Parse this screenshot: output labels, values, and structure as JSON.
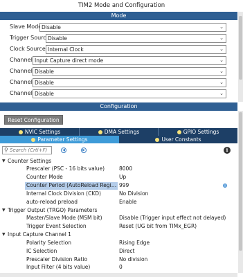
{
  "window_title": "TIM2 Mode and Configuration",
  "mode_section": {
    "title": "Mode",
    "rows": [
      {
        "label": "Slave Mode",
        "value": "Disable"
      },
      {
        "label": "Trigger Source",
        "value": "Disable"
      },
      {
        "label": "Clock Source",
        "value": "Internal Clock"
      },
      {
        "label": "Channel1",
        "value": "Input Capture direct mode"
      },
      {
        "label": "Channel2",
        "value": "Disable"
      },
      {
        "label": "Channel3",
        "value": "Disable"
      },
      {
        "label": "Channel4",
        "value": "Disable"
      }
    ]
  },
  "config_section": {
    "title": "Configuration",
    "reset_button": "Reset Configuration",
    "tabs_row1": [
      "NVIC Settings",
      "DMA Settings",
      "GPIO Settings"
    ],
    "tabs_row2": [
      "Parameter Settings",
      "User Constants"
    ],
    "search_placeholder": "Search (Crtl+F)",
    "groups": [
      {
        "name": "Counter Settings",
        "params": [
          {
            "name": "Prescaler (PSC - 16 bits value)",
            "value": "8000"
          },
          {
            "name": "Counter Mode",
            "value": "Up"
          },
          {
            "name": "Counter Period (AutoReload Registe...",
            "value": "999",
            "selected": true
          },
          {
            "name": "Internal Clock Division (CKD)",
            "value": "No Division"
          },
          {
            "name": "auto-reload preload",
            "value": "Enable"
          }
        ]
      },
      {
        "name": "Trigger Output (TRGO) Parameters",
        "params": [
          {
            "name": "Master/Slave Mode (MSM bit)",
            "value": "Disable (Trigger input effect not delayed)"
          },
          {
            "name": "Trigger Event Selection",
            "value": "Reset (UG bit from TIMx_EGR)"
          }
        ]
      },
      {
        "name": "Input Capture Channel 1",
        "params": [
          {
            "name": "Polarity Selection",
            "value": "Rising Edge"
          },
          {
            "name": "IC Selection",
            "value": "Direct"
          },
          {
            "name": "Prescaler Division Ratio",
            "value": "No division"
          },
          {
            "name": "Input Filter (4 bits value)",
            "value": "0"
          }
        ]
      }
    ]
  },
  "icons": {
    "dropdown": "chevron-down-icon",
    "search": "search-icon",
    "info": "info-icon",
    "reset_dot": "reset-value-icon"
  },
  "colors": {
    "section_bar": "#2f5f93",
    "tab_dark": "#1d3f66",
    "tab_active": "#3e9bd8",
    "selection": "#b4cdea"
  }
}
